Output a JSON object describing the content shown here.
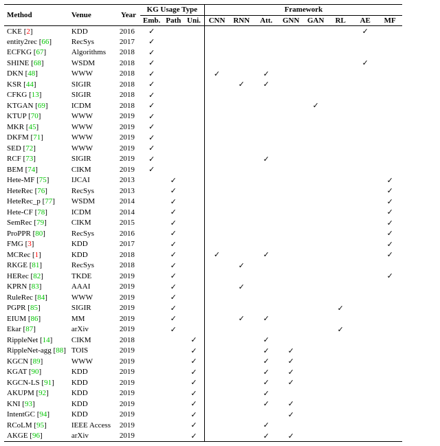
{
  "header": {
    "method": "Method",
    "venue": "Venue",
    "year": "Year",
    "kg_group": "KG Usage Type",
    "fw_group": "Framework",
    "kg": {
      "emb": "Emb.",
      "path": "Path",
      "uni": "Uni."
    },
    "fw": {
      "cnn": "CNN",
      "rnn": "RNN",
      "att": "Att.",
      "gnn": "GNN",
      "gan": "GAN",
      "rl": "RL",
      "ae": "AE",
      "mf": "MF"
    }
  },
  "tick": "✓",
  "rows": [
    {
      "name": "CKE",
      "cite": "2",
      "citeColor": "red",
      "venue": "KDD",
      "year": "2016",
      "kg": [
        "emb"
      ],
      "fw": [
        "ae"
      ]
    },
    {
      "name": "entity2rec",
      "cite": "66",
      "venue": "RecSys",
      "year": "2017",
      "kg": [
        "emb"
      ],
      "fw": []
    },
    {
      "name": "ECFKG",
      "cite": "67",
      "venue": "Algorithms",
      "year": "2018",
      "kg": [
        "emb"
      ],
      "fw": []
    },
    {
      "name": "SHINE",
      "cite": "68",
      "venue": "WSDM",
      "year": "2018",
      "kg": [
        "emb"
      ],
      "fw": [
        "ae"
      ]
    },
    {
      "name": "DKN",
      "cite": "48",
      "venue": "WWW",
      "year": "2018",
      "kg": [
        "emb"
      ],
      "fw": [
        "cnn",
        "att"
      ]
    },
    {
      "name": "KSR",
      "cite": "44",
      "venue": "SIGIR",
      "year": "2018",
      "kg": [
        "emb"
      ],
      "fw": [
        "rnn",
        "att"
      ]
    },
    {
      "name": "CFKG",
      "cite": "13",
      "venue": "SIGIR",
      "year": "2018",
      "kg": [
        "emb"
      ],
      "fw": []
    },
    {
      "name": "KTGAN",
      "cite": "69",
      "venue": "ICDM",
      "year": "2018",
      "kg": [
        "emb"
      ],
      "fw": [
        "gan"
      ]
    },
    {
      "name": "KTUP",
      "cite": "70",
      "venue": "WWW",
      "year": "2019",
      "kg": [
        "emb"
      ],
      "fw": []
    },
    {
      "name": "MKR",
      "cite": "45",
      "venue": "WWW",
      "year": "2019",
      "kg": [
        "emb"
      ],
      "fw": []
    },
    {
      "name": "DKFM",
      "cite": "71",
      "venue": "WWW",
      "year": "2019",
      "kg": [
        "emb"
      ],
      "fw": []
    },
    {
      "name": "SED",
      "cite": "72",
      "venue": "WWW",
      "year": "2019",
      "kg": [
        "emb"
      ],
      "fw": []
    },
    {
      "name": "RCF",
      "cite": "73",
      "venue": "SIGIR",
      "year": "2019",
      "kg": [
        "emb"
      ],
      "fw": [
        "att"
      ]
    },
    {
      "name": "BEM",
      "cite": "74",
      "venue": "CIKM",
      "year": "2019",
      "kg": [
        "emb"
      ],
      "fw": []
    },
    {
      "name": "Hete-MF",
      "cite": "75",
      "venue": "IJCAI",
      "year": "2013",
      "kg": [
        "path"
      ],
      "fw": [
        "mf"
      ]
    },
    {
      "name": "HeteRec",
      "cite": "76",
      "venue": "RecSys",
      "year": "2013",
      "kg": [
        "path"
      ],
      "fw": [
        "mf"
      ]
    },
    {
      "name": "HeteRec_p",
      "cite": "77",
      "venue": "WSDM",
      "year": "2014",
      "kg": [
        "path"
      ],
      "fw": [
        "mf"
      ]
    },
    {
      "name": "Hete-CF",
      "cite": "78",
      "venue": "ICDM",
      "year": "2014",
      "kg": [
        "path"
      ],
      "fw": [
        "mf"
      ]
    },
    {
      "name": "SemRec",
      "cite": "79",
      "venue": "CIKM",
      "year": "2015",
      "kg": [
        "path"
      ],
      "fw": [
        "mf"
      ]
    },
    {
      "name": "ProPPR",
      "cite": "80",
      "venue": "RecSys",
      "year": "2016",
      "kg": [
        "path"
      ],
      "fw": [
        "mf"
      ]
    },
    {
      "name": "FMG",
      "cite": "3",
      "citeColor": "red",
      "venue": "KDD",
      "year": "2017",
      "kg": [
        "path"
      ],
      "fw": [
        "mf"
      ]
    },
    {
      "name": "MCRec",
      "cite": "1",
      "citeColor": "red",
      "venue": "KDD",
      "year": "2018",
      "kg": [
        "path"
      ],
      "fw": [
        "cnn",
        "att",
        "mf"
      ]
    },
    {
      "name": "RKGE",
      "cite": "81",
      "venue": "RecSys",
      "year": "2018",
      "kg": [
        "path"
      ],
      "fw": [
        "rnn"
      ]
    },
    {
      "name": "HERec",
      "cite": "82",
      "venue": "TKDE",
      "year": "2019",
      "kg": [
        "path"
      ],
      "fw": [
        "mf"
      ]
    },
    {
      "name": "KPRN",
      "cite": "83",
      "venue": "AAAI",
      "year": "2019",
      "kg": [
        "path"
      ],
      "fw": [
        "rnn"
      ]
    },
    {
      "name": "RuleRec",
      "cite": "84",
      "venue": "WWW",
      "year": "2019",
      "kg": [
        "path"
      ],
      "fw": []
    },
    {
      "name": "PGPR",
      "cite": "85",
      "venue": "SIGIR",
      "year": "2019",
      "kg": [
        "path"
      ],
      "fw": [
        "rl"
      ]
    },
    {
      "name": "EIUM",
      "cite": "86",
      "venue": "MM",
      "year": "2019",
      "kg": [
        "path"
      ],
      "fw": [
        "rnn",
        "att"
      ]
    },
    {
      "name": "Ekar",
      "cite": "87",
      "venue": "arXiv",
      "year": "2019",
      "kg": [
        "path"
      ],
      "fw": [
        "rl"
      ]
    },
    {
      "name": "RippleNet",
      "cite": "14",
      "venue": "CIKM",
      "year": "2018",
      "kg": [
        "uni"
      ],
      "fw": [
        "att"
      ]
    },
    {
      "name": "RippleNet-agg",
      "cite": "88",
      "venue": "TOIS",
      "year": "2019",
      "kg": [
        "uni"
      ],
      "fw": [
        "att",
        "gnn"
      ]
    },
    {
      "name": "KGCN",
      "cite": "89",
      "venue": "WWW",
      "year": "2019",
      "kg": [
        "uni"
      ],
      "fw": [
        "att",
        "gnn"
      ]
    },
    {
      "name": "KGAT",
      "cite": "90",
      "venue": "KDD",
      "year": "2019",
      "kg": [
        "uni"
      ],
      "fw": [
        "att",
        "gnn"
      ]
    },
    {
      "name": "KGCN-LS",
      "cite": "91",
      "venue": "KDD",
      "year": "2019",
      "kg": [
        "uni"
      ],
      "fw": [
        "att",
        "gnn"
      ]
    },
    {
      "name": "AKUPM",
      "cite": "92",
      "venue": "KDD",
      "year": "2019",
      "kg": [
        "uni"
      ],
      "fw": [
        "att"
      ]
    },
    {
      "name": "KNI",
      "cite": "93",
      "venue": "KDD",
      "year": "2019",
      "kg": [
        "uni"
      ],
      "fw": [
        "att",
        "gnn"
      ]
    },
    {
      "name": "IntentGC",
      "cite": "94",
      "venue": "KDD",
      "year": "2019",
      "kg": [
        "uni"
      ],
      "fw": [
        "gnn"
      ]
    },
    {
      "name": "RCoLM",
      "cite": "95",
      "venue": "IEEE Access",
      "year": "2019",
      "kg": [
        "uni"
      ],
      "fw": [
        "att"
      ]
    },
    {
      "name": "AKGE",
      "cite": "96",
      "venue": "arXiv",
      "year": "2019",
      "kg": [
        "uni"
      ],
      "fw": [
        "att",
        "gnn"
      ]
    }
  ]
}
